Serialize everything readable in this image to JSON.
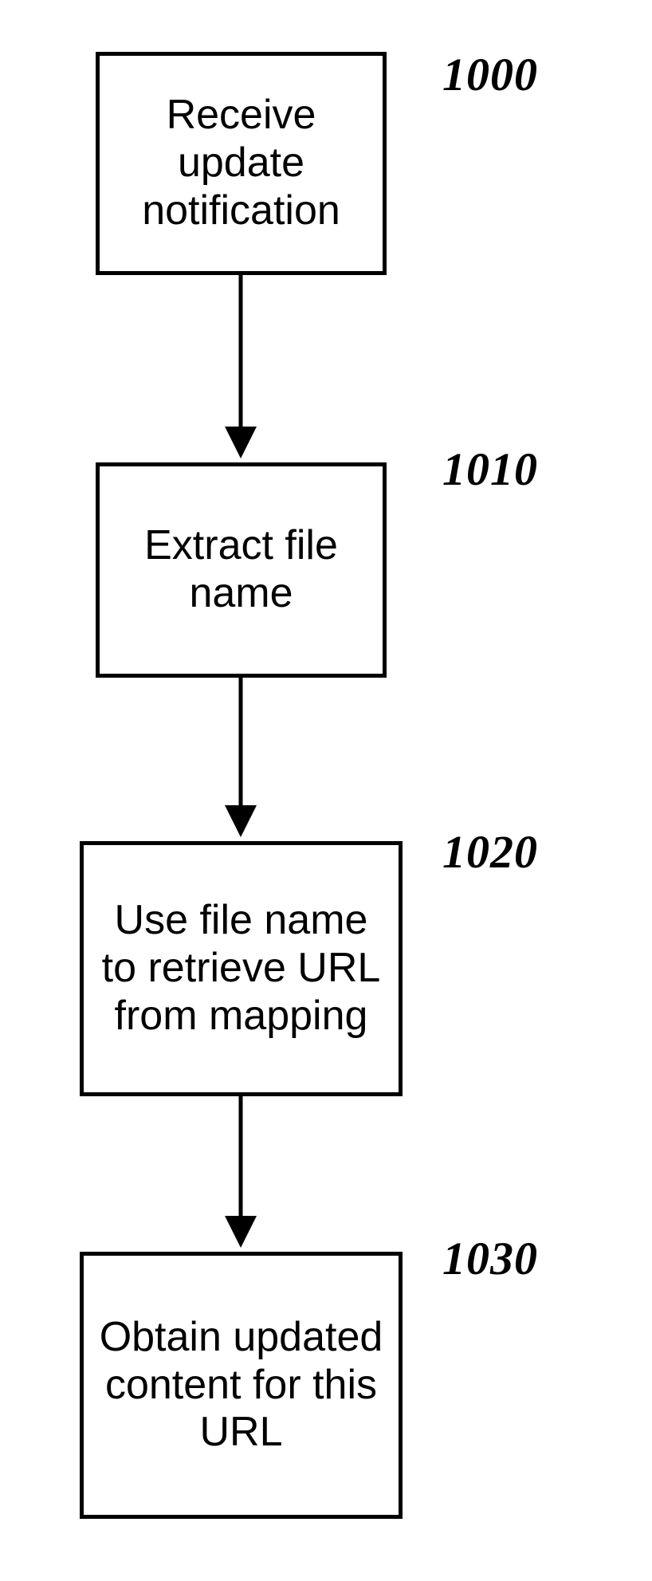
{
  "chart_data": {
    "type": "flowchart",
    "nodes": [
      {
        "id": "n1000",
        "ref": "1000",
        "text": "Receive update notification"
      },
      {
        "id": "n1010",
        "ref": "1010",
        "text": "Extract file name"
      },
      {
        "id": "n1020",
        "ref": "1020",
        "text": "Use file name to retrieve URL from mapping"
      },
      {
        "id": "n1030",
        "ref": "1030",
        "text": "Obtain updated content for this URL"
      }
    ],
    "edges": [
      {
        "from": "n1000",
        "to": "n1010"
      },
      {
        "from": "n1010",
        "to": "n1020"
      },
      {
        "from": "n1020",
        "to": "n1030"
      }
    ]
  },
  "nodes": {
    "n1000": {
      "text": "Receive update notification",
      "ref": "1000"
    },
    "n1010": {
      "text": "Extract file name",
      "ref": "1010"
    },
    "n1020": {
      "text": "Use file name to retrieve URL from mapping",
      "ref": "1020"
    },
    "n1030": {
      "text": "Obtain updated content for this URL",
      "ref": "1030"
    }
  }
}
